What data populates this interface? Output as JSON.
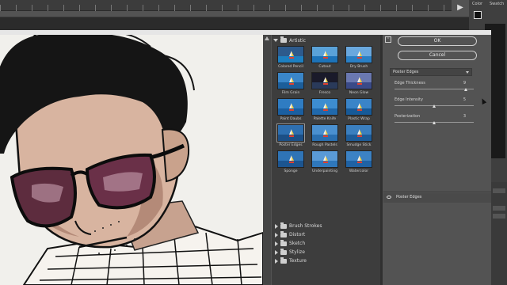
{
  "photoshop": {
    "right_tabs": [
      "Color",
      "Swatch"
    ]
  },
  "dialog": {
    "gallery": {
      "category_open": "Artistic",
      "filters": [
        {
          "label": "Colored Pencil",
          "sky": "#2d5a8c",
          "sea": "#1e7fc0",
          "selected": false
        },
        {
          "label": "Cutout",
          "sky": "#5aa2d8",
          "sea": "#1d73b8",
          "selected": false
        },
        {
          "label": "Dry Brush",
          "sky": "#6aa8de",
          "sea": "#2a7fc4",
          "selected": false
        },
        {
          "label": "Film Grain",
          "sky": "#3a86c8",
          "sea": "#1c5e9a",
          "selected": false
        },
        {
          "label": "Fresco",
          "sky": "#1a1a2a",
          "sea": "#2a3a5a",
          "selected": false
        },
        {
          "label": "Neon Glow",
          "sky": "#6a78b0",
          "sea": "#3a4a88",
          "selected": false
        },
        {
          "label": "Paint Daubs",
          "sky": "#2f7cc2",
          "sea": "#1b5fa0",
          "selected": false
        },
        {
          "label": "Palette Knife",
          "sky": "#3d8dd0",
          "sea": "#2069ac",
          "selected": false
        },
        {
          "label": "Plastic Wrap",
          "sky": "#3a84c8",
          "sea": "#175a98",
          "selected": false
        },
        {
          "label": "Poster Edges",
          "sky": "#2e6fb0",
          "sea": "#1c4f86",
          "selected": true
        },
        {
          "label": "Rough Pastels",
          "sky": "#4a90d0",
          "sea": "#2a6fb0",
          "selected": false
        },
        {
          "label": "Smudge Stick",
          "sky": "#3b7fbf",
          "sea": "#1e5c99",
          "selected": false
        },
        {
          "label": "Sponge",
          "sky": "#2f74b6",
          "sea": "#1c5590",
          "selected": false
        },
        {
          "label": "Underpainting",
          "sky": "#5a9ad6",
          "sea": "#2f78bc",
          "selected": false
        },
        {
          "label": "Watercolor",
          "sky": "#3c82c4",
          "sea": "#1f62a4",
          "selected": false
        }
      ],
      "collapsed_categories": [
        "Brush Strokes",
        "Distort",
        "Sketch",
        "Stylize",
        "Texture"
      ]
    },
    "controls": {
      "ok_label": "OK",
      "cancel_label": "Cancel",
      "selected_filter": "Poster Edges",
      "sliders": [
        {
          "label": "Edge Thickness",
          "value": "9",
          "fraction": 0.9
        },
        {
          "label": "Edge Intensity",
          "value": "5",
          "fraction": 0.5
        },
        {
          "label": "Posterization",
          "value": "3",
          "fraction": 0.5
        }
      ],
      "layer_name": "Poster Edges"
    }
  }
}
